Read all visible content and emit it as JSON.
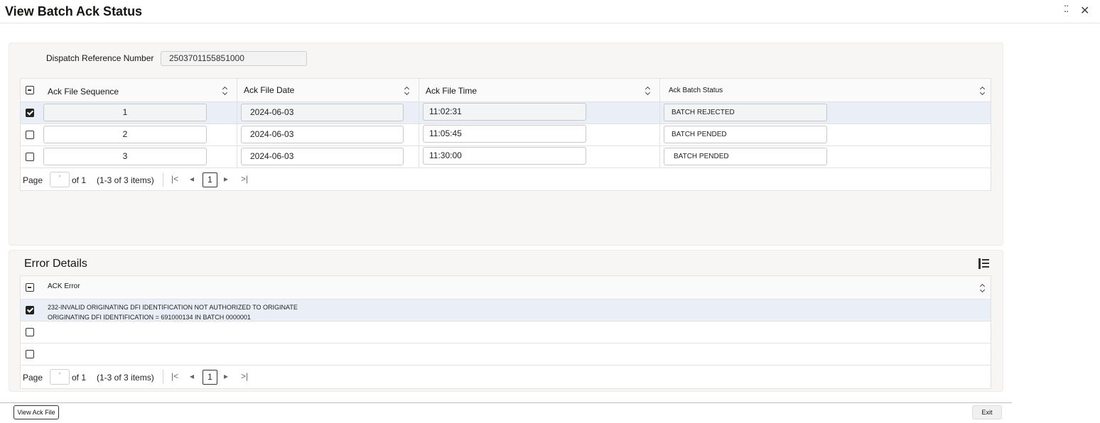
{
  "window": {
    "title": "View Batch Ack Status",
    "expand_glyph": "⛶",
    "close_glyph": "✕"
  },
  "dispatch": {
    "label": "Dispatch Reference Number",
    "value": "2503701155851000"
  },
  "ack_grid": {
    "columns": [
      "Ack File Sequence",
      "Ack File Date",
      "Ack File Time",
      "Ack Batch Status"
    ],
    "rows": [
      {
        "selected": true,
        "sequence": "1",
        "date": "2024-06-03",
        "time": "11:02:31",
        "status": "BATCH REJECTED"
      },
      {
        "selected": false,
        "sequence": "2",
        "date": "2024-06-03",
        "time": "11:05:45",
        "status": "BATCH PENDED"
      },
      {
        "selected": false,
        "sequence": "3",
        "date": "2024-06-03",
        "time": "11:30:00",
        "status": "BATCH PENDED"
      }
    ],
    "pager": {
      "page_label": "Page",
      "page_value": "'",
      "of_text": "of 1",
      "items_text": "(1-3 of 3 items)",
      "current": "1",
      "first": "|<",
      "prev": "◂",
      "next": "▸",
      "last": ">|"
    }
  },
  "error_details": {
    "title": "Error Details",
    "column": "ACK Error",
    "rows": [
      {
        "selected": true,
        "line1": "232-INVALID ORIGINATING DFI IDENTIFICATION NOT AUTHORIZED TO ORIGINATE",
        "line2": "ORIGINATING DFI IDENTIFICATION = 691000134 IN BATCH 0000001"
      },
      {
        "selected": false,
        "line1": "",
        "line2": ""
      },
      {
        "selected": false,
        "line1": "",
        "line2": ""
      }
    ],
    "pager": {
      "page_label": "Page",
      "page_value": "'",
      "of_text": "of 1",
      "items_text": "(1-3 of 3 items)",
      "current": "1",
      "first": "|<",
      "prev": "◂",
      "next": "▸",
      "last": ">|"
    }
  },
  "footer": {
    "view_ack_file": "View Ack File",
    "exit": "Exit"
  }
}
